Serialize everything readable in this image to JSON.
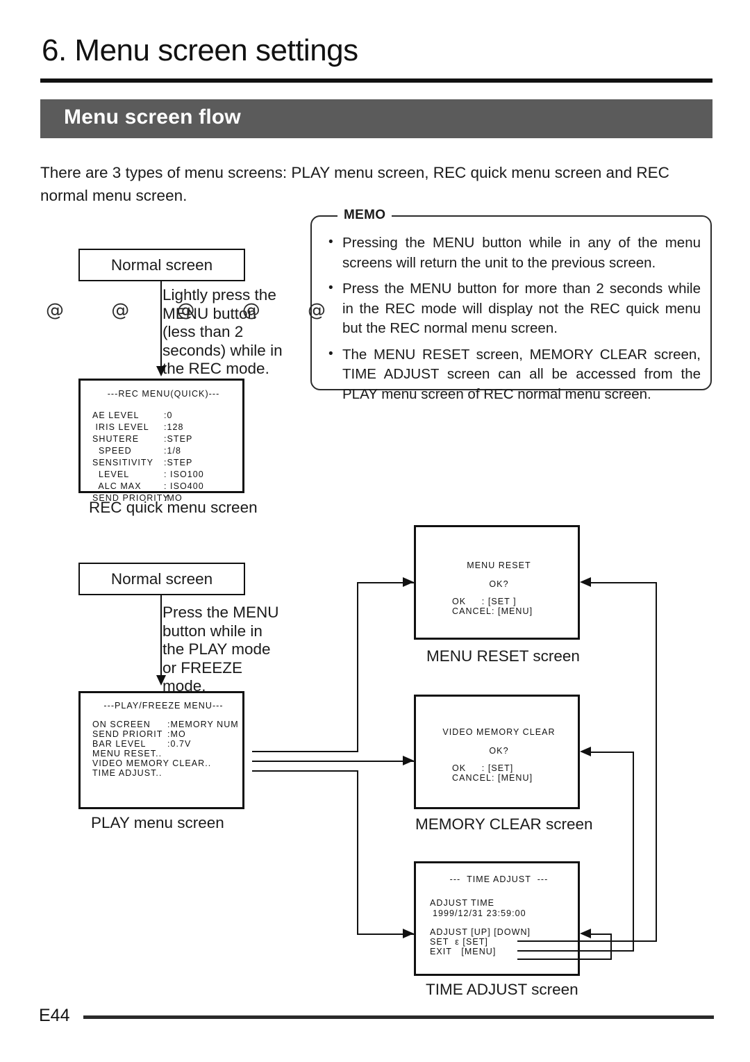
{
  "header": {
    "chapter_title": "6. Menu screen settings",
    "section_title": "Menu screen flow"
  },
  "intro": "There are 3 types of menu screens: PLAY menu screen, REC quick menu screen and REC normal menu screen.",
  "memo": {
    "title": "MEMO",
    "bullet_glyph": "•",
    "items": [
      "Pressing the MENU button while in any of the menu screens will return the unit to the previous screen.",
      "Press the MENU button for more than 2 seconds while in the REC mode will display not the REC quick menu but the REC normal menu screen.",
      "The MENU RESET screen, MEMORY CLEAR screen, TIME ADJUST screen can all be accessed from the PLAY menu screen of REC normal menu screen."
    ]
  },
  "flow": {
    "normal_screen_top": "Normal screen",
    "normal_screen_bottom": "Normal screen",
    "note_rec": "Lightly press the MENU button (less than 2 seconds) while in the REC mode.",
    "note_play": "Press the MENU button while in the PLAY mode or FREEZE mode.",
    "artifact_glyphs": "@ @ @ @ @",
    "captions": {
      "rec_quick": "REC quick menu screen",
      "play_menu": "PLAY menu screen",
      "menu_reset": "MENU RESET screen",
      "memory_clear": "MEMORY CLEAR screen",
      "time_adjust": "TIME ADJUST screen"
    }
  },
  "osd": {
    "rec_quick": {
      "title": "---REC MENU(QUICK)---",
      "rows": [
        {
          "label": "AE LEVEL",
          "value": ":0"
        },
        {
          "label": " IRIS LEVEL",
          "value": ":128"
        },
        {
          "label": "SHUTERE",
          "value": ":STEP"
        },
        {
          "label": "  SPEED",
          "value": ":1/8"
        },
        {
          "label": "SENSITIVITY",
          "value": ":STEP"
        },
        {
          "label": "  LEVEL",
          "value": ": ISO100"
        },
        {
          "label": "  ALC MAX",
          "value": ": ISO400"
        },
        {
          "label": "SEND PRIORITY",
          "value": ":MO"
        }
      ]
    },
    "play_menu": {
      "title": "---PLAY/FREEZE MENU---",
      "rows": [
        {
          "label": "ON SCREEN",
          "value": ":MEMORY NUM"
        },
        {
          "label": "SEND PRIORIT",
          "value": ":MO"
        },
        {
          "label": "BAR LEVEL",
          "value": ":0.7V"
        },
        {
          "label": "MENU RESET..",
          "value": ""
        },
        {
          "label": "VIDEO MEMORY CLEAR..",
          "value": ""
        },
        {
          "label": "TIME ADJUST..",
          "value": ""
        }
      ]
    },
    "menu_reset": {
      "title": "MENU RESET",
      "prompt": "OK?",
      "ok_line": "OK     : [SET ]",
      "cancel_line": "CANCEL: [MENU]"
    },
    "memory_clear": {
      "title": "VIDEO MEMORY CLEAR",
      "prompt": "OK?",
      "ok_line": "OK     : [SET]",
      "cancel_line": "CANCEL: [MENU]"
    },
    "time_adjust": {
      "title": "---  TIME ADJUST  ---",
      "label_time": "ADJUST TIME",
      "value_time": "1999/12/31 23:59:00",
      "row_adjust": "ADJUST [UP] [DOWN]",
      "row_set": "SET  ε [SET]",
      "row_exit": "EXIT   [MENU]"
    }
  },
  "footer": {
    "page": "E44"
  },
  "colors": {
    "section_bar": "#5b5b5b",
    "ink": "#111111"
  }
}
